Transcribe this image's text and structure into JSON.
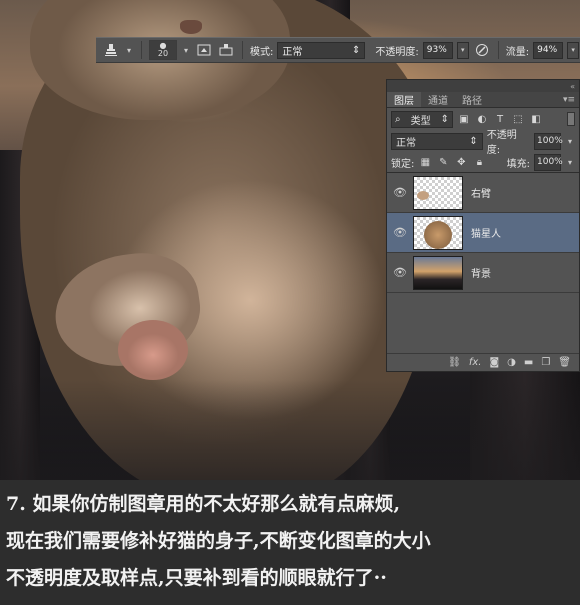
{
  "options_bar": {
    "brush_size": "20",
    "mode_label": "模式:",
    "mode_value": "正常",
    "opacity_label": "不透明度:",
    "opacity_value": "93%",
    "flow_label": "流量:",
    "flow_value": "94%"
  },
  "layers_panel": {
    "tabs": [
      "图层",
      "通道",
      "路径"
    ],
    "filter_kind": "类型",
    "blend_mode": "正常",
    "opacity_label": "不透明度:",
    "opacity_value": "100%",
    "lock_label": "锁定:",
    "fill_label": "填充:",
    "fill_value": "100%",
    "layers": [
      {
        "name": "右臂",
        "visible": true,
        "selected": false
      },
      {
        "name": "猫星人",
        "visible": true,
        "selected": true
      },
      {
        "name": "背景",
        "visible": true,
        "selected": false
      }
    ],
    "footer_fx": "fx."
  },
  "caption": {
    "line1": "7. 如果你仿制图章用的不太好那么就有点麻烦,",
    "line2": "现在我们需要修补好猫的身子,不断变化图章的大小",
    "line3": "不透明度及取样点,只要补到看的顺眼就行了··"
  }
}
